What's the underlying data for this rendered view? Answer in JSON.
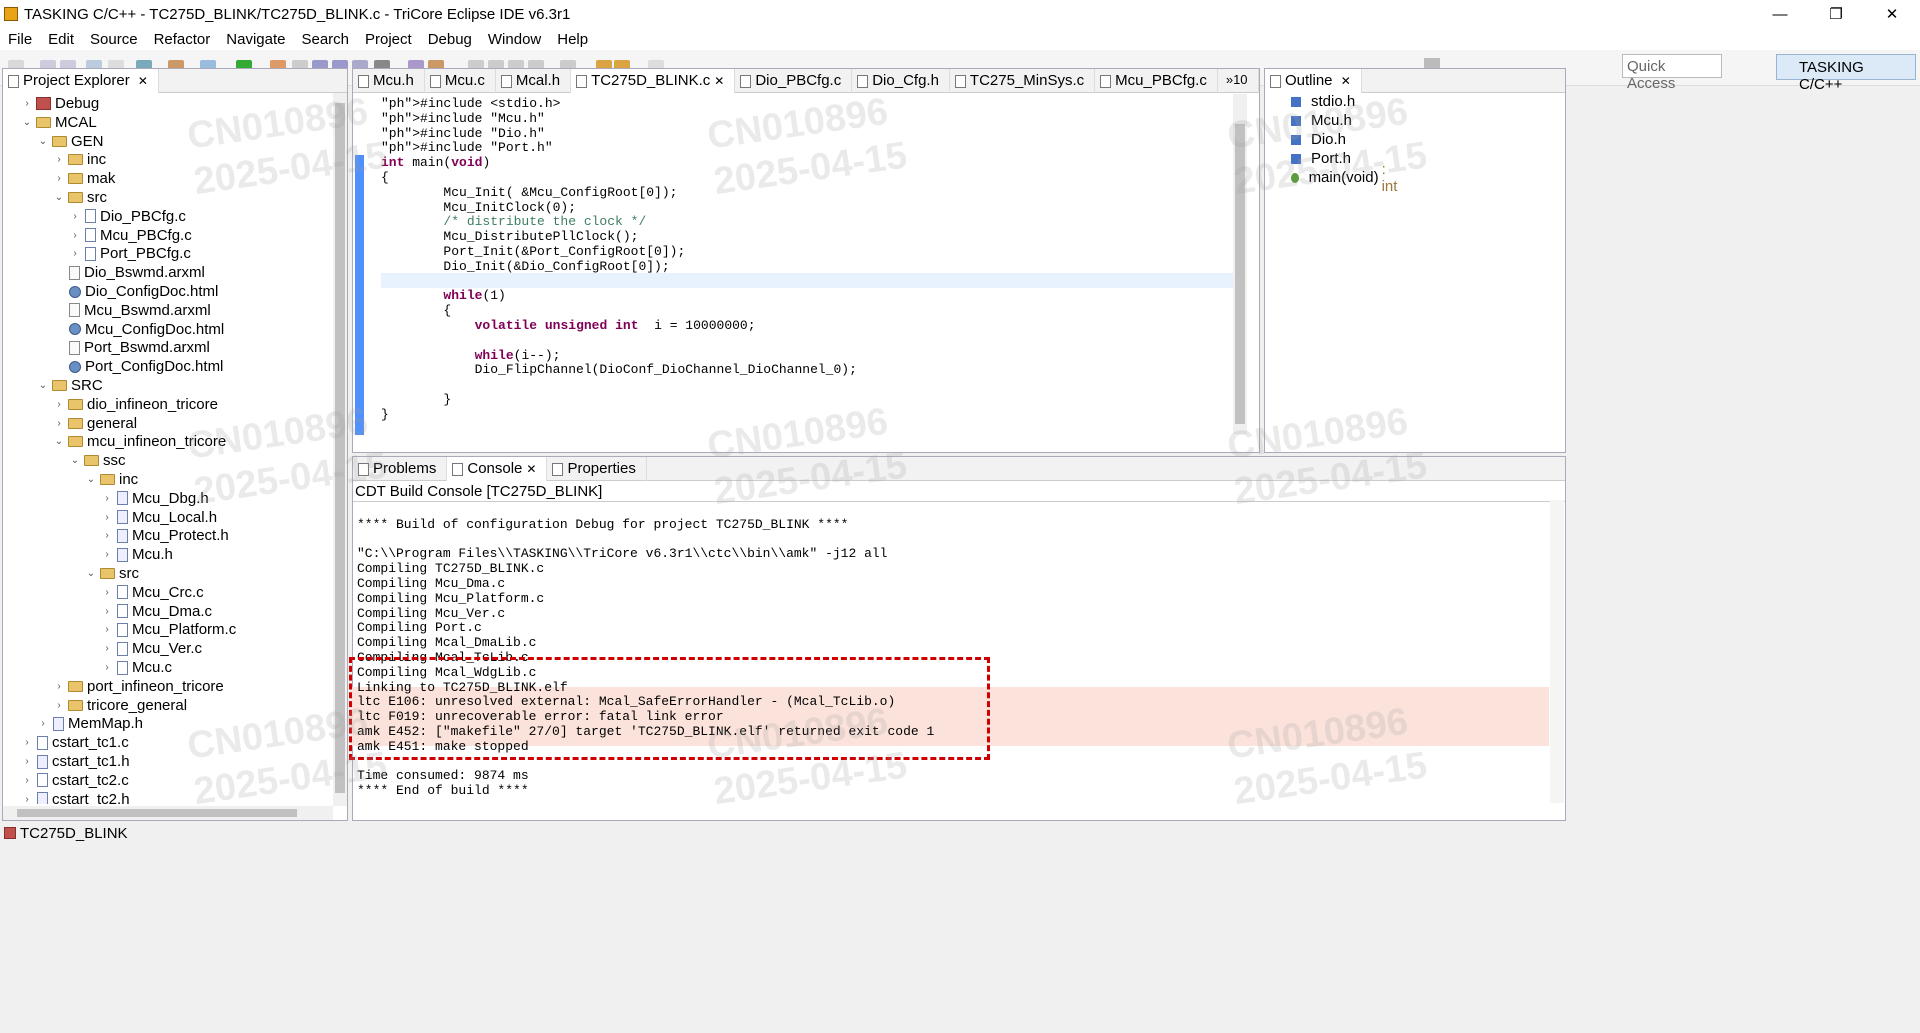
{
  "window": {
    "title": "TASKING C/C++ - TC275D_BLINK/TC275D_BLINK.c - TriCore Eclipse IDE v6.3r1"
  },
  "menu": [
    "File",
    "Edit",
    "Source",
    "Refactor",
    "Navigate",
    "Search",
    "Project",
    "Debug",
    "Window",
    "Help"
  ],
  "toolbar": {
    "quick_access": "Quick Access",
    "perspective": "TASKING C/C++"
  },
  "project_explorer": {
    "title": "Project Explorer",
    "rows": [
      {
        "label": "Debug",
        "depth": 1,
        "kind": "folder",
        "arrow": "›"
      },
      {
        "label": "MCAL",
        "depth": 1,
        "kind": "folder",
        "arrow": "⌄"
      },
      {
        "label": "GEN",
        "depth": 2,
        "kind": "folder",
        "arrow": "⌄"
      },
      {
        "label": "inc",
        "depth": 3,
        "kind": "folder",
        "arrow": "›"
      },
      {
        "label": "mak",
        "depth": 3,
        "kind": "folder",
        "arrow": "›"
      },
      {
        "label": "src",
        "depth": 3,
        "kind": "folder",
        "arrow": "⌄"
      },
      {
        "label": "Dio_PBCfg.c",
        "depth": 4,
        "kind": "c",
        "arrow": "›"
      },
      {
        "label": "Mcu_PBCfg.c",
        "depth": 4,
        "kind": "c",
        "arrow": "›"
      },
      {
        "label": "Port_PBCfg.c",
        "depth": 4,
        "kind": "c",
        "arrow": "›"
      },
      {
        "label": "Dio_Bswmd.arxml",
        "depth": 3,
        "kind": "x",
        "arrow": ""
      },
      {
        "label": "Dio_ConfigDoc.html",
        "depth": 3,
        "kind": "html",
        "arrow": ""
      },
      {
        "label": "Mcu_Bswmd.arxml",
        "depth": 3,
        "kind": "x",
        "arrow": ""
      },
      {
        "label": "Mcu_ConfigDoc.html",
        "depth": 3,
        "kind": "html",
        "arrow": ""
      },
      {
        "label": "Port_Bswmd.arxml",
        "depth": 3,
        "kind": "x",
        "arrow": ""
      },
      {
        "label": "Port_ConfigDoc.html",
        "depth": 3,
        "kind": "html",
        "arrow": ""
      },
      {
        "label": "SRC",
        "depth": 2,
        "kind": "folder",
        "arrow": "⌄"
      },
      {
        "label": "dio_infineon_tricore",
        "depth": 3,
        "kind": "folder",
        "arrow": "›"
      },
      {
        "label": "general",
        "depth": 3,
        "kind": "folder",
        "arrow": "›"
      },
      {
        "label": "mcu_infineon_tricore",
        "depth": 3,
        "kind": "folder",
        "arrow": "⌄"
      },
      {
        "label": "ssc",
        "depth": 4,
        "kind": "folder",
        "arrow": "⌄"
      },
      {
        "label": "inc",
        "depth": 5,
        "kind": "folder",
        "arrow": "⌄"
      },
      {
        "label": "Mcu_Dbg.h",
        "depth": 6,
        "kind": "h",
        "arrow": "›"
      },
      {
        "label": "Mcu_Local.h",
        "depth": 6,
        "kind": "h",
        "arrow": "›"
      },
      {
        "label": "Mcu_Protect.h",
        "depth": 6,
        "kind": "h",
        "arrow": "›"
      },
      {
        "label": "Mcu.h",
        "depth": 6,
        "kind": "h",
        "arrow": "›"
      },
      {
        "label": "src",
        "depth": 5,
        "kind": "folder",
        "arrow": "⌄"
      },
      {
        "label": "Mcu_Crc.c",
        "depth": 6,
        "kind": "c",
        "arrow": "›"
      },
      {
        "label": "Mcu_Dma.c",
        "depth": 6,
        "kind": "c",
        "arrow": "›"
      },
      {
        "label": "Mcu_Platform.c",
        "depth": 6,
        "kind": "c",
        "arrow": "›"
      },
      {
        "label": "Mcu_Ver.c",
        "depth": 6,
        "kind": "c",
        "arrow": "›"
      },
      {
        "label": "Mcu.c",
        "depth": 6,
        "kind": "c",
        "arrow": "›"
      },
      {
        "label": "port_infineon_tricore",
        "depth": 3,
        "kind": "folder",
        "arrow": "›"
      },
      {
        "label": "tricore_general",
        "depth": 3,
        "kind": "folder",
        "arrow": "›"
      },
      {
        "label": "MemMap.h",
        "depth": 2,
        "kind": "h",
        "arrow": "›"
      },
      {
        "label": "cstart_tc1.c",
        "depth": 1,
        "kind": "c",
        "arrow": "›"
      },
      {
        "label": "cstart_tc1.h",
        "depth": 1,
        "kind": "h",
        "arrow": "›"
      },
      {
        "label": "cstart_tc2.c",
        "depth": 1,
        "kind": "c",
        "arrow": "›"
      },
      {
        "label": "cstart_tc2.h",
        "depth": 1,
        "kind": "h",
        "arrow": "›"
      }
    ]
  },
  "editor": {
    "tabs": [
      "Mcu.h",
      "Mcu.c",
      "Mcal.h",
      "TC275D_BLINK.c",
      "Dio_PBCfg.c",
      "Dio_Cfg.h",
      "TC275_MinSys.c",
      "Mcu_PBCfg.c"
    ],
    "active_tab": "TC275D_BLINK.c",
    "overflow": "»10",
    "lines": [
      "#include <stdio.h>",
      "#include \"Mcu.h\"",
      "#include \"Dio.h\"",
      "#include \"Port.h\"",
      "int main(void)",
      "{",
      "        Mcu_Init( &Mcu_ConfigRoot[0]);",
      "        Mcu_InitClock(0);",
      "        /* distribute the clock */",
      "        Mcu_DistributePllClock();",
      "        Port_Init(&Port_ConfigRoot[0]);",
      "        Dio_Init(&Dio_ConfigRoot[0]);",
      "",
      "        while(1)",
      "        {",
      "            volatile unsigned int  i = 10000000;",
      "",
      "            while(i--);",
      "            Dio_FlipChannel(DioConf_DioChannel_DioChannel_0);",
      "",
      "        }",
      "}"
    ]
  },
  "outline": {
    "title": "Outline",
    "items": [
      "stdio.h",
      "Mcu.h",
      "Dio.h",
      "Port.h"
    ],
    "function": "main(void)",
    "function_type": ": int"
  },
  "bottom": {
    "tabs": [
      "Problems",
      "Console",
      "Properties"
    ],
    "console_title": "CDT Build Console [TC275D_BLINK]",
    "lines": [
      "",
      "**** Build of configuration Debug for project TC275D_BLINK ****",
      "",
      "\"C:\\\\Program Files\\\\TASKING\\\\TriCore v6.3r1\\\\ctc\\\\bin\\\\amk\" -j12 all",
      "Compiling TC275D_BLINK.c",
      "Compiling Mcu_Dma.c",
      "Compiling Mcu_Platform.c",
      "Compiling Mcu_Ver.c",
      "Compiling Port.c",
      "Compiling Mcal_DmaLib.c",
      "Compiling Mcal_TcLib.c",
      "Compiling Mcal_WdgLib.c",
      "Linking to TC275D_BLINK.elf",
      "ltc E106: unresolved external: Mcal_SafeErrorHandler - (Mcal_TcLib.o)",
      "ltc F019: unrecoverable error: fatal link error",
      "amk E452: [\"makefile\" 27/0] target 'TC275D_BLINK.elf' returned exit code 1",
      "amk E451: make stopped",
      "",
      "Time consumed: 9874 ms",
      "**** End of build ****"
    ]
  },
  "status_bar": {
    "text": "TC275D_BLINK"
  },
  "watermark": {
    "id": "CN010896",
    "date": "2025-04-15"
  }
}
